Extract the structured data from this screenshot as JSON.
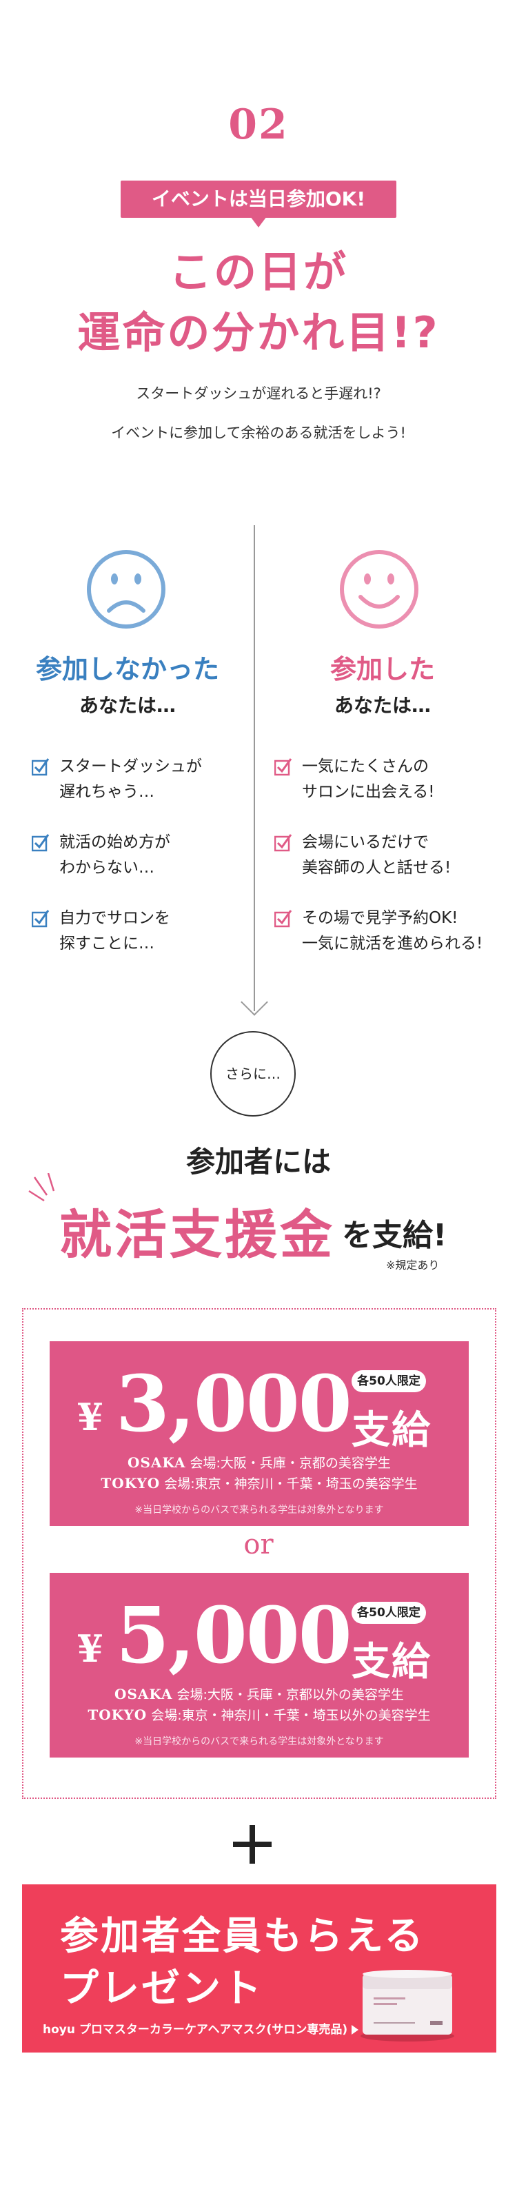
{
  "section": {
    "number": "02",
    "badge": "イベントは当日参加OK!",
    "headline_line1": "この日が",
    "headline_line2": "運命の分かれ目!?",
    "lead_line1": "スタートダッシュが遅れると手遅れ!?",
    "lead_line2": "イベントに参加して余裕のある就活をしよう!"
  },
  "comparison": {
    "left": {
      "title": "参加しなかった",
      "subtitle": "あなたは…",
      "items": [
        [
          "スタートダッシュが",
          "遅れちゃう…"
        ],
        [
          "就活の始め方が",
          "わからない…"
        ],
        [
          "自力でサロンを",
          "探すことに…"
        ]
      ]
    },
    "right": {
      "title": "参加した",
      "subtitle": "あなたは…",
      "items": [
        [
          "一気にたくさんの",
          "サロンに出会える!"
        ],
        [
          "会場にいるだけで",
          "美容師の人と話せる!"
        ],
        [
          "その場で見学予約OK!",
          "一気に就活を進められる!"
        ]
      ]
    }
  },
  "bonus": {
    "circle": "さらに…",
    "participant": "参加者には",
    "big": "就活支援金",
    "big_tail": "を支給!",
    "rule_note": "※規定あり"
  },
  "panels": [
    {
      "yen": "¥",
      "amount": "3,000",
      "limit": "各50人限定",
      "shikyu": "支給",
      "osaka_label": "OSAKA",
      "osaka_text": "会場:大阪・兵庫・京都の美容学生",
      "tokyo_label": "TOKYO",
      "tokyo_text": "会場:東京・神奈川・千葉・埼玉の美容学生",
      "note": "※当日学校からのバスで来られる学生は対象外となります"
    },
    {
      "yen": "¥",
      "amount": "5,000",
      "limit": "各50人限定",
      "shikyu": "支給",
      "osaka_label": "OSAKA",
      "osaka_text": "会場:大阪・兵庫・京都以外の美容学生",
      "tokyo_label": "TOKYO",
      "tokyo_text": "会場:東京・神奈川・千葉・埼玉以外の美容学生",
      "note": "※当日学校からのバスで来られる学生は対象外となります"
    }
  ],
  "or_text": "or",
  "present": {
    "line1": "参加者全員もらえる",
    "line2": "プレゼント",
    "product": "hoyu プロマスターカラーケアヘアマスク(サロン専売品)"
  },
  "colors": {
    "pink": "#e05a86",
    "blue": "#3a80c0",
    "red": "#ef3f5a"
  },
  "icons": {
    "sad_face": "sad-face-icon",
    "happy_face": "happy-face-icon",
    "check": "checkbox-check-icon",
    "plus": "plus-icon",
    "arrow": "arrow-down-icon"
  }
}
